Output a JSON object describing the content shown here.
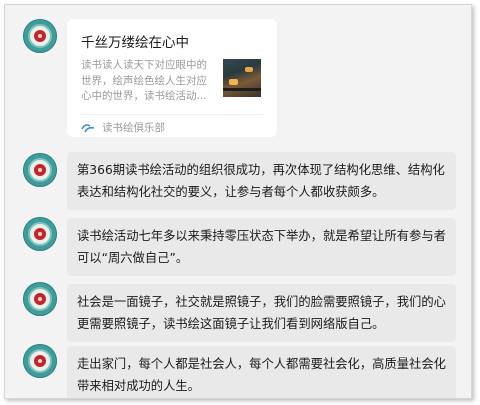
{
  "card": {
    "title": "千丝万缕绘在心中",
    "description": "读书读人读天下对应眼中的世界，绘声绘色绘人生对应心中的世界，读书绘活动...",
    "source_icon": "link-icon",
    "source_label": "读书绘俱乐部"
  },
  "messages": [
    {
      "text": "第366期读书绘活动的组织很成功，再次体现了结构化思维、结构化表达和结构化社交的要义，让参与者每个人都收获颇多。"
    },
    {
      "text": "读书绘活动七年多以来秉持零压状态下举办，就是希望让所有参与者可以“周六做自己”。"
    },
    {
      "text": "社会是一面镜子，社交就是照镜子，我们的脸需要照镜子，我们的心更需要照镜子，读书绘这面镜子让我们看到网络版自己。"
    },
    {
      "text": "走出家门，每个人都是社会人，每个人都需要社会化，高质量社会化带来相对成功的人生。"
    }
  ],
  "colors": {
    "avatar_teal": "#3e9d9c",
    "avatar_red": "#c0262c",
    "bubble_bg": "#e9e9e9"
  }
}
